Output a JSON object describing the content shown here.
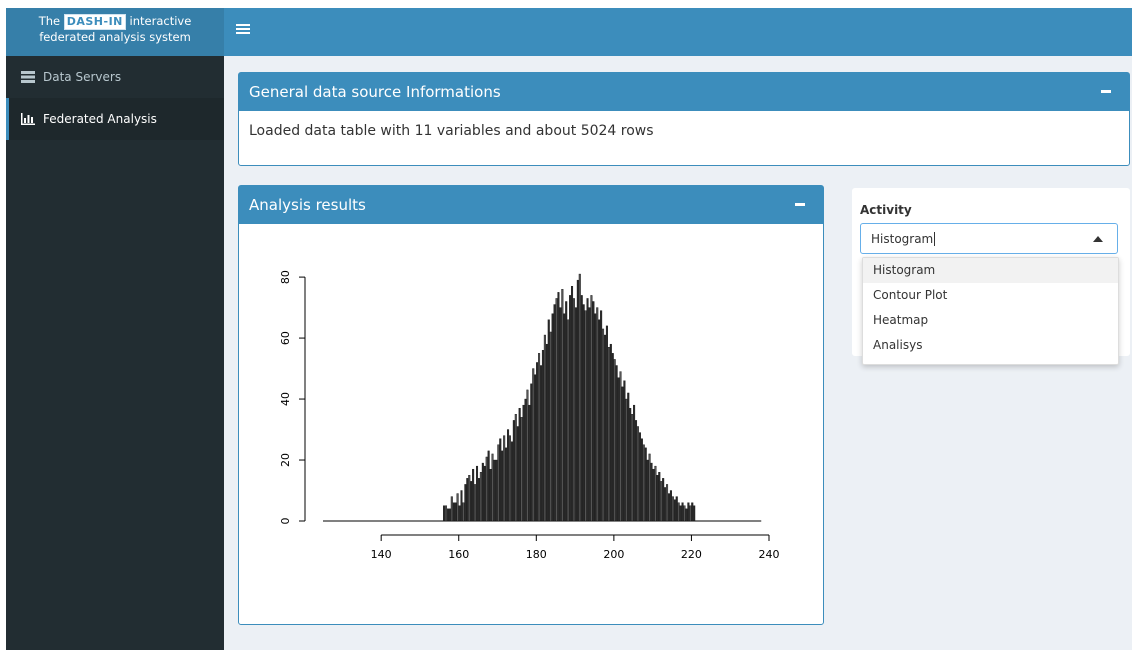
{
  "header": {
    "brand_prefix": "The",
    "brand_logo_text": "DASH-IN",
    "brand_suffix": "interactive",
    "brand_line2": "federated analysis system"
  },
  "sidebar": {
    "items": [
      {
        "label": "Data Servers",
        "icon": "server-icon",
        "active": false
      },
      {
        "label": "Federated Analysis",
        "icon": "bar-chart-icon",
        "active": true
      }
    ]
  },
  "general_box": {
    "title": "General data source Informations",
    "text": "Loaded data table with 11 variables and about 5024 rows"
  },
  "analysis_box": {
    "title": "Analysis results"
  },
  "activity": {
    "label": "Activity",
    "selected": "Histogram",
    "options": [
      "Histogram",
      "Contour Plot",
      "Heatmap",
      "Analisys"
    ]
  },
  "colors": {
    "primary": "#3c8dbc",
    "header_dark": "#367fa9",
    "sidebar_bg": "#222d32",
    "content_bg": "#ecf0f5",
    "bar_fill": "#2a2a2a"
  },
  "chart_data": {
    "type": "bar",
    "title": "",
    "xlabel": "",
    "ylabel": "",
    "xlim": [
      125,
      240
    ],
    "ylim": [
      0,
      82
    ],
    "x_ticks": [
      140,
      160,
      180,
      200,
      220,
      240
    ],
    "y_ticks": [
      0,
      20,
      40,
      60,
      80
    ],
    "grid": false,
    "bin_width": 0.5,
    "x_start": 156,
    "values": [
      5,
      5,
      4,
      4,
      8,
      6,
      6,
      9,
      5,
      10,
      6,
      12,
      14,
      15,
      13,
      17,
      12,
      18,
      14,
      16,
      19,
      18,
      21,
      23,
      17,
      22,
      20,
      20,
      25,
      27,
      23,
      28,
      24,
      30,
      28,
      26,
      33,
      35,
      31,
      37,
      34,
      38,
      40,
      43,
      38,
      45,
      50,
      48,
      52,
      55,
      51,
      56,
      61,
      58,
      66,
      62,
      68,
      71,
      73,
      75,
      70,
      76,
      68,
      72,
      66,
      74,
      77,
      73,
      70,
      79,
      81,
      74,
      71,
      69,
      73,
      70,
      74,
      72,
      68,
      70,
      66,
      69,
      63,
      61,
      64,
      57,
      58,
      55,
      53,
      51,
      47,
      49,
      44,
      46,
      40,
      42,
      37,
      35,
      38,
      33,
      31,
      29,
      27,
      25,
      24,
      20,
      22,
      19,
      17,
      18,
      15,
      16,
      13,
      14,
      11,
      12,
      9,
      10,
      8,
      7,
      8,
      6,
      5,
      6,
      5,
      4,
      6,
      5,
      6,
      5
    ]
  }
}
